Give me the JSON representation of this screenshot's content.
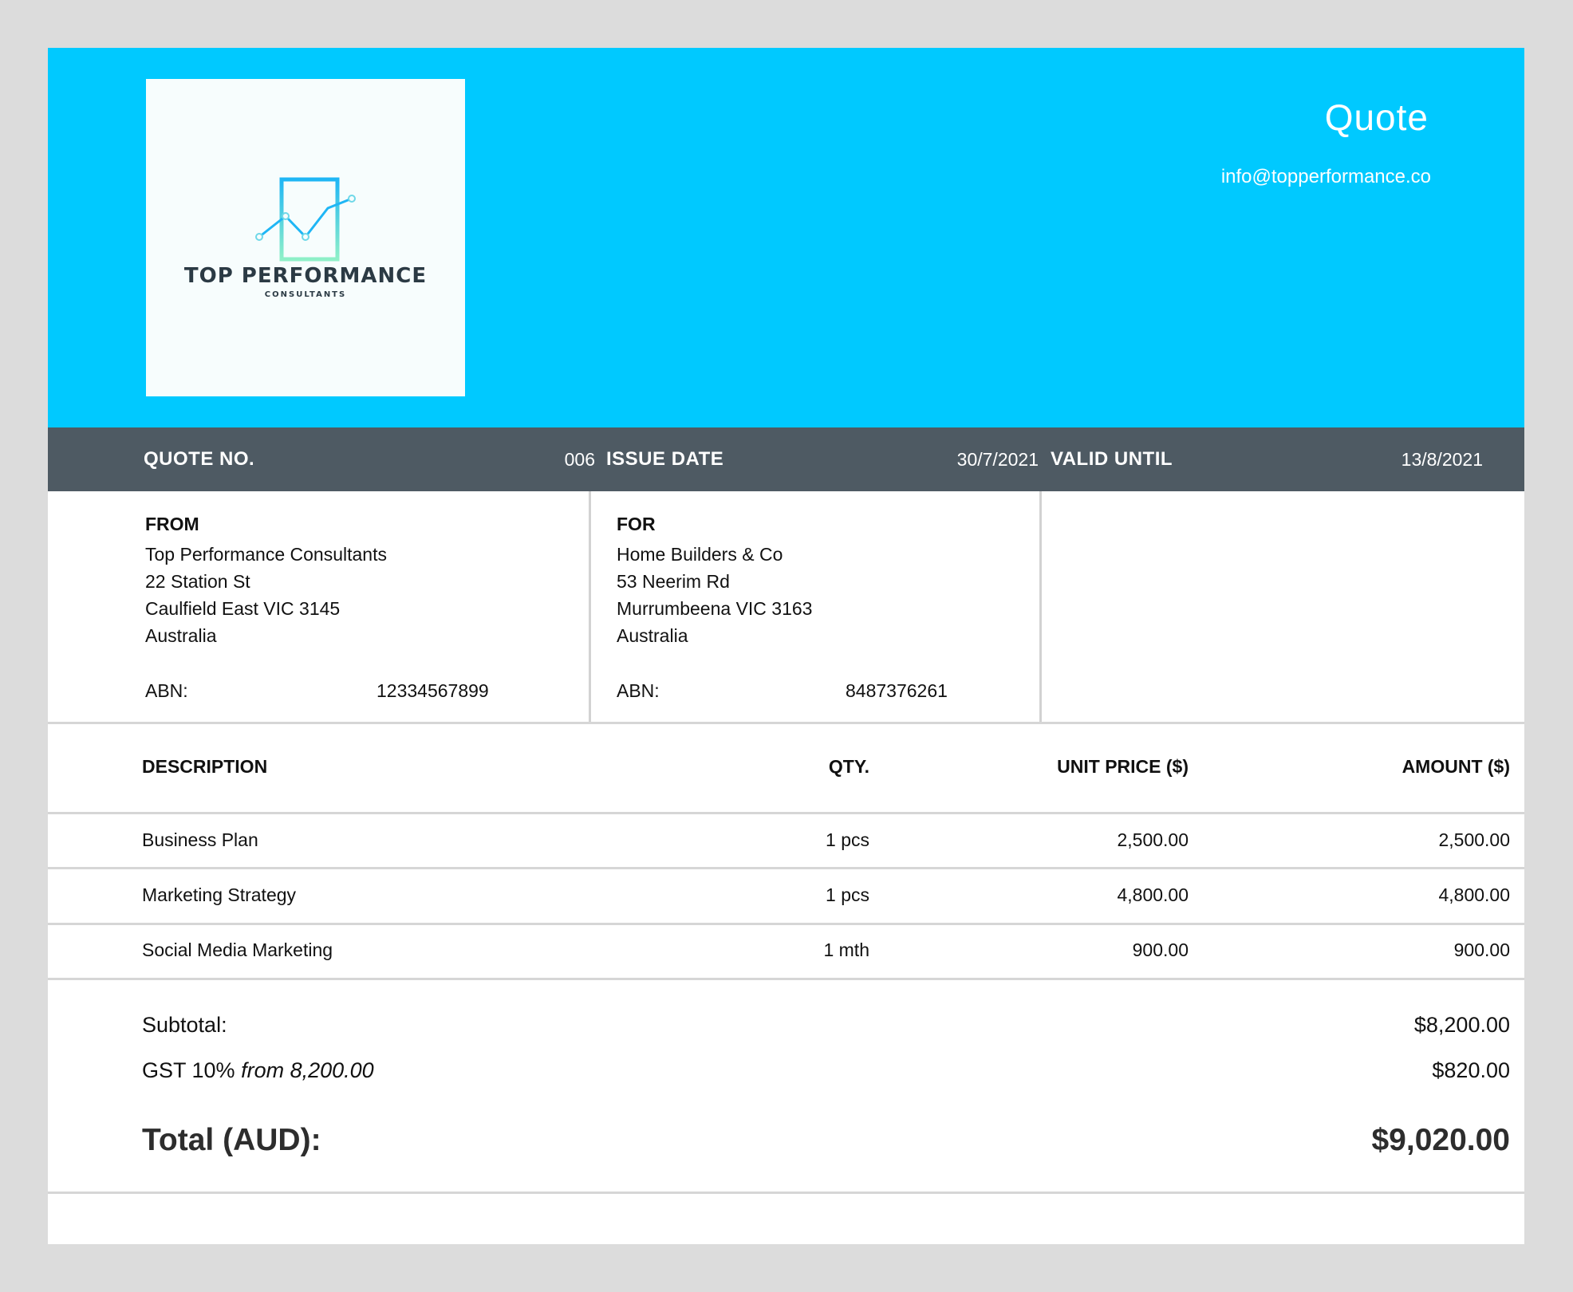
{
  "header": {
    "logo": {
      "name": "TOP PERFORMANCE",
      "sub": "CONSULTANTS"
    },
    "title": "Quote",
    "email": "info@topperformance.co"
  },
  "meta": {
    "quote_no_label": "QUOTE NO.",
    "quote_no": "006",
    "issue_date_label": "ISSUE DATE",
    "issue_date": "30/7/2021",
    "valid_until_label": "VALID UNTIL",
    "valid_until": "13/8/2021"
  },
  "from": {
    "title": "FROM",
    "lines": [
      "Top Performance Consultants",
      "22 Station St",
      "Caulfield East VIC 3145",
      "Australia"
    ],
    "abn_label": "ABN:",
    "abn": "12334567899"
  },
  "for": {
    "title": "FOR",
    "lines": [
      "Home Builders & Co",
      "53 Neerim Rd",
      "Murrumbeena VIC 3163",
      "Australia"
    ],
    "abn_label": "ABN:",
    "abn": "8487376261"
  },
  "table": {
    "headers": [
      "DESCRIPTION",
      "QTY.",
      "UNIT PRICE ($)",
      "AMOUNT ($)"
    ],
    "rows": [
      {
        "description": "Business Plan",
        "qty": "1 pcs",
        "unit_price": "2,500.00",
        "amount": "2,500.00"
      },
      {
        "description": "Marketing Strategy",
        "qty": "1 pcs",
        "unit_price": "4,800.00",
        "amount": "4,800.00"
      },
      {
        "description": "Social Media Marketing",
        "qty": "1 mth",
        "unit_price": "900.00",
        "amount": "900.00"
      }
    ]
  },
  "totals": {
    "subtotal_label": "Subtotal:",
    "subtotal": "$8,200.00",
    "gst_label": "GST 10%",
    "gst_note": "from 8,200.00",
    "gst": "$820.00",
    "total_label": "Total (AUD):",
    "total": "$9,020.00"
  },
  "colors": {
    "header_bg": "#00c9ff",
    "meta_bar_bg": "#4e5a63",
    "page_bg": "#dcdcdc"
  }
}
